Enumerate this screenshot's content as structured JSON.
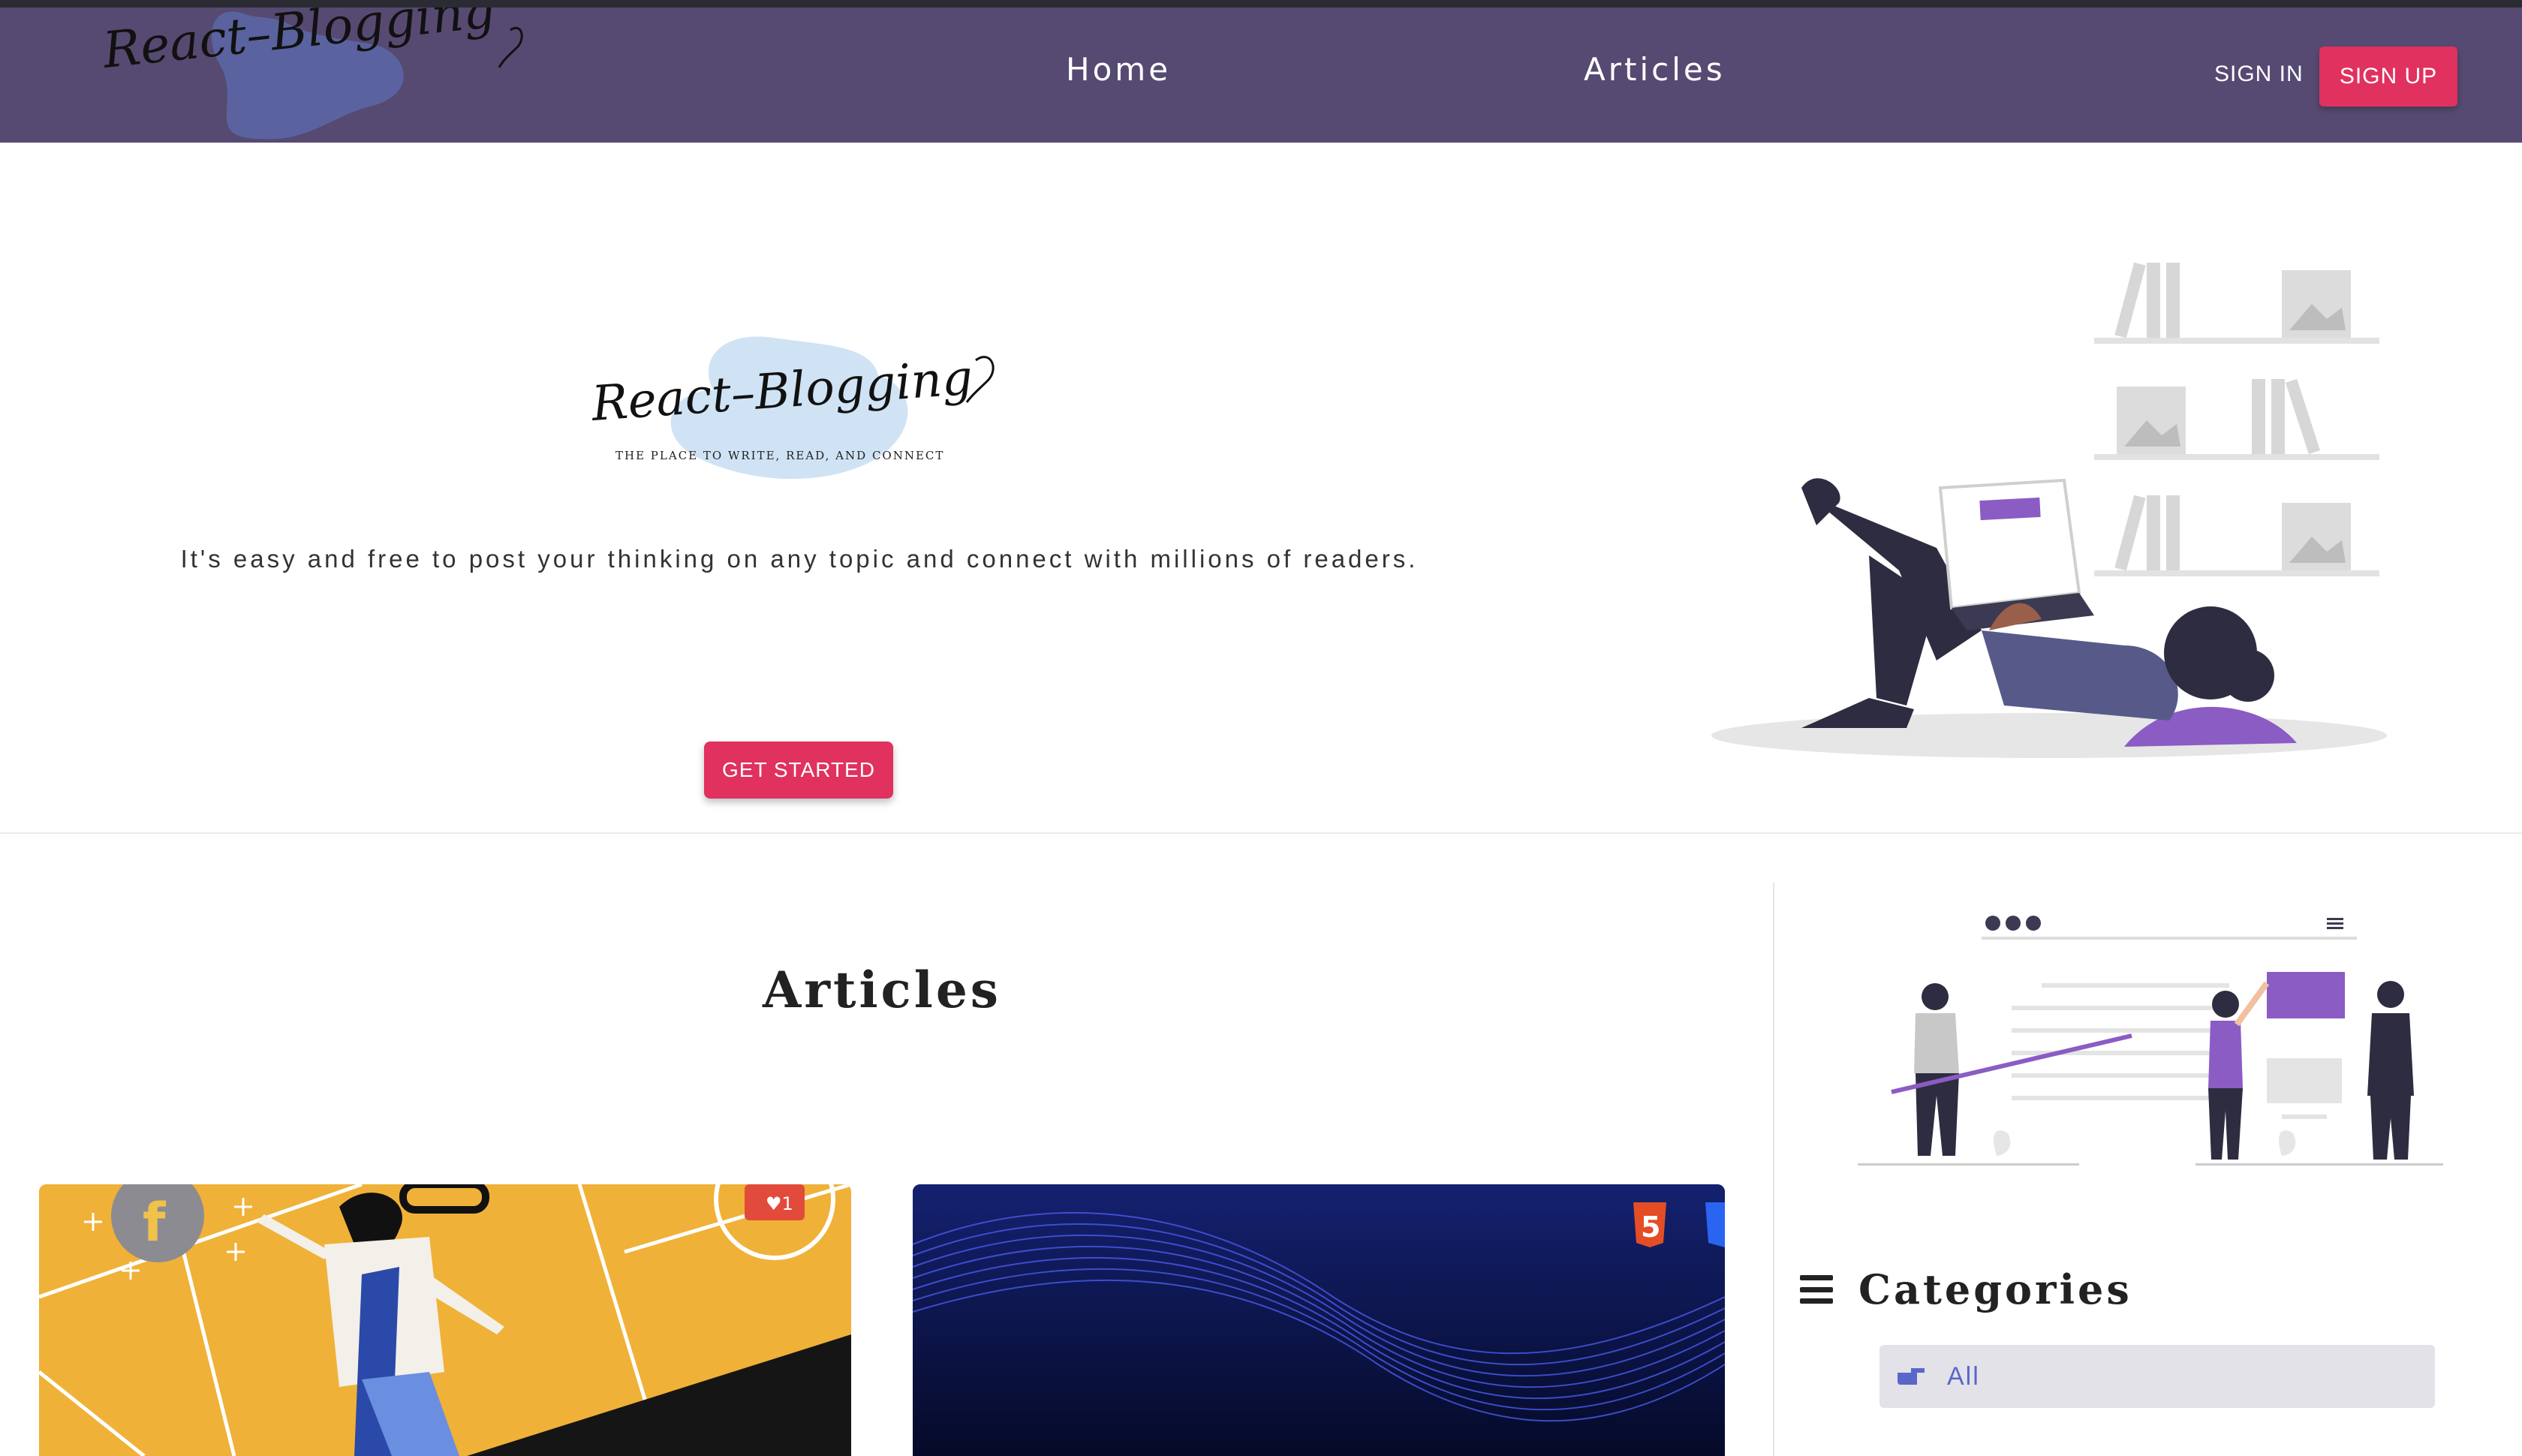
{
  "brand": {
    "logo_text": "React–Blogging",
    "logo_subtitle": "THE PLACE TO WRITE, READ, AND CONNECT"
  },
  "nav": {
    "home": "Home",
    "articles": "Articles",
    "sign_in": "SIGN IN",
    "sign_up": "SIGN UP"
  },
  "hero": {
    "tagline": "It's easy and free to post your thinking on any topic and connect with millions of readers.",
    "cta": "GET STARTED"
  },
  "articles": {
    "title": "Articles"
  },
  "sidebar": {
    "categories_title": "Categories",
    "categories": [
      {
        "label": "All",
        "selected": true
      }
    ]
  },
  "colors": {
    "navbar": "#564a72",
    "accent": "#e0315f",
    "category_text": "#5b66c9",
    "illustration_purple": "#8a5cc4"
  }
}
